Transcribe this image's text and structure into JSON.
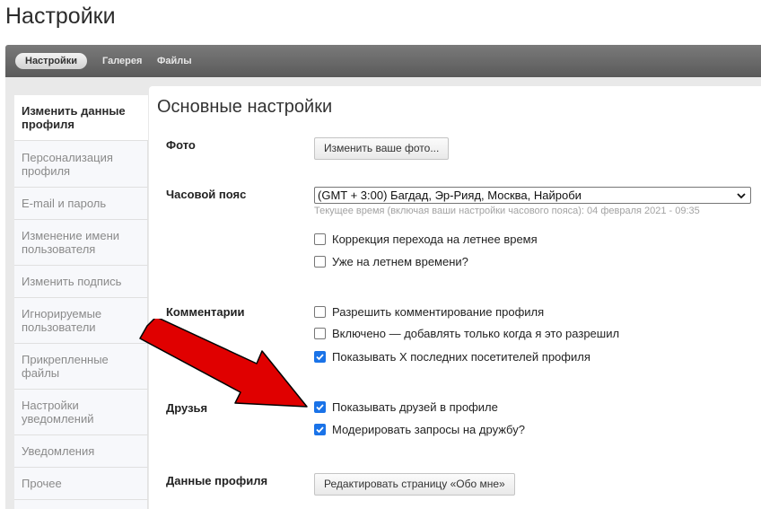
{
  "page": {
    "title": "Настройки"
  },
  "tabs": [
    {
      "label": "Настройки",
      "active": true
    },
    {
      "label": "Галерея",
      "active": false
    },
    {
      "label": "Файлы",
      "active": false
    }
  ],
  "sidebar": {
    "items": [
      {
        "label": "Изменить данные профиля",
        "active": true
      },
      {
        "label": "Персонализация профиля",
        "active": false
      },
      {
        "label": "E-mail и пароль",
        "active": false
      },
      {
        "label": "Изменение имени пользователя",
        "active": false
      },
      {
        "label": "Изменить подпись",
        "active": false
      },
      {
        "label": "Игнорируемые пользователи",
        "active": false
      },
      {
        "label": "Прикрепленные файлы",
        "active": false
      },
      {
        "label": "Настройки уведомлений",
        "active": false
      },
      {
        "label": "Уведомления",
        "active": false
      },
      {
        "label": "Прочее",
        "active": false
      }
    ]
  },
  "main": {
    "title": "Основные настройки",
    "photo": {
      "label": "Фото",
      "button": "Изменить ваше фото..."
    },
    "timezone": {
      "label": "Часовой пояс",
      "selected": "(GMT + 3:00) Багдад, Эр-Рияд, Москва, Найроби",
      "hint": "Текущее время (включая ваши настройки часового пояса): 04 февраля 2021 - 09:35",
      "options": [
        {
          "label": "Коррекция перехода на летнее время",
          "checked": false
        },
        {
          "label": "Уже на летнем времени?",
          "checked": false
        }
      ]
    },
    "comments": {
      "label": "Комментарии",
      "options": [
        {
          "label": "Разрешить комментирование профиля",
          "checked": false
        },
        {
          "label": "Включено — добавлять только когда я это разрешил",
          "checked": false
        },
        {
          "label": "Показывать X последних посетителей профиля",
          "checked": true
        }
      ]
    },
    "friends": {
      "label": "Друзья",
      "options": [
        {
          "label": "Показывать друзей в профиле",
          "checked": true
        },
        {
          "label": "Модерировать запросы на дружбу?",
          "checked": true
        }
      ]
    },
    "profile_data": {
      "label": "Данные профиля",
      "button": "Редактировать страницу «Обо мне»"
    }
  },
  "colors": {
    "checkbox_checked": "#1a73e8",
    "arrow": "#e00000",
    "tabbar": "#666666"
  }
}
